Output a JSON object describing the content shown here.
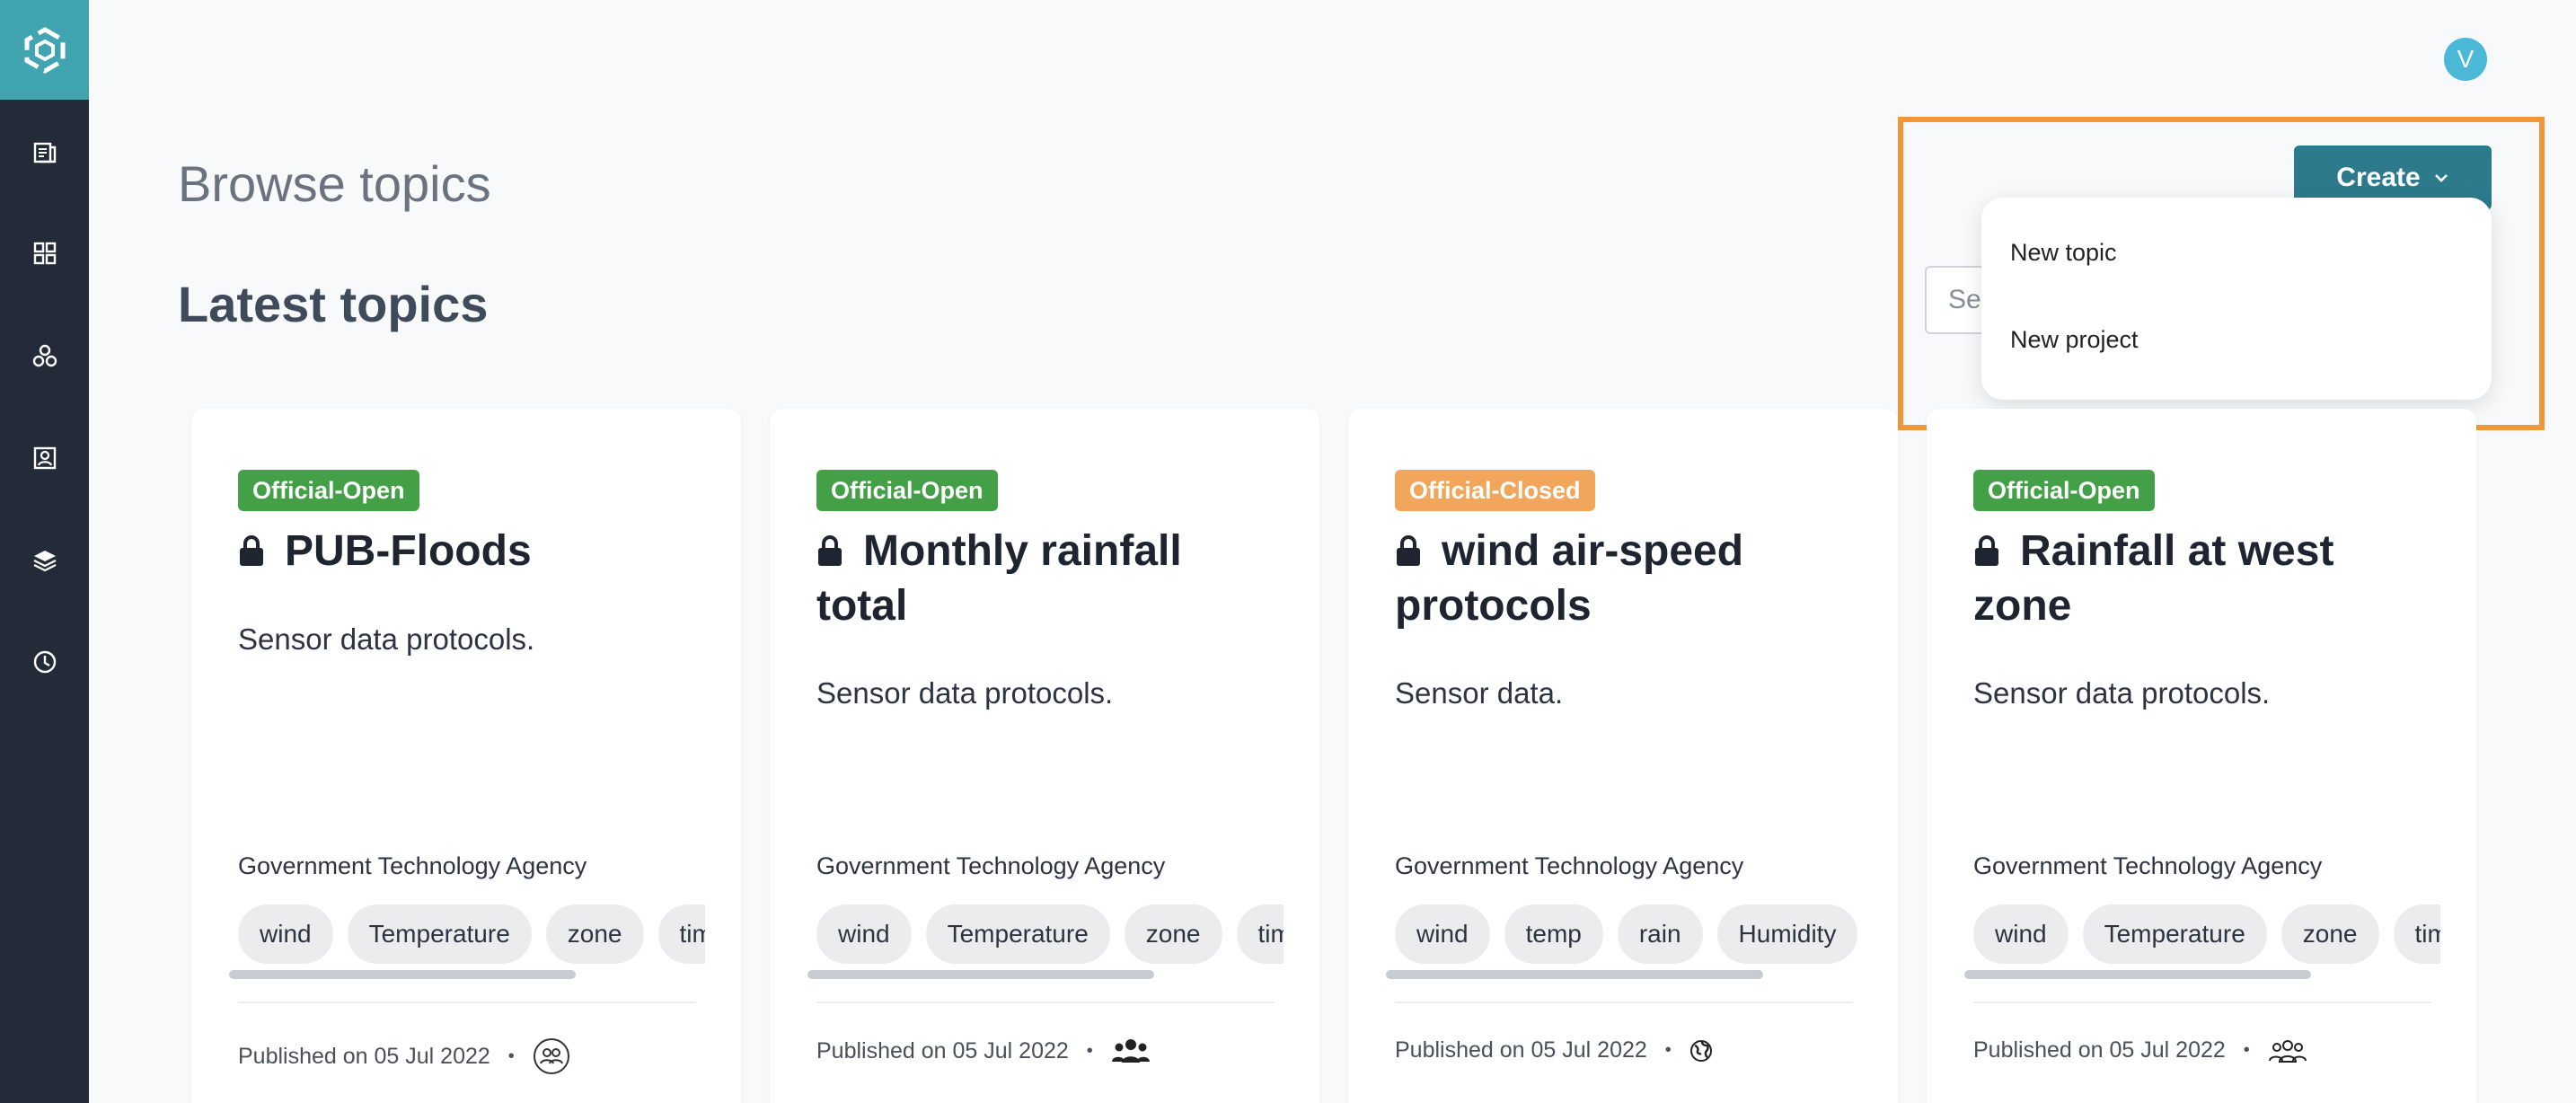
{
  "header": {
    "page_title": "Browse topics",
    "section_title": "Latest topics",
    "avatar_initial": "V",
    "create_label": "Create",
    "search_placeholder": "Se"
  },
  "dropdown": {
    "items": [
      {
        "label": "New topic"
      },
      {
        "label": "New project"
      }
    ]
  },
  "sidebar": {
    "items": [
      {
        "icon": "catalog-icon"
      },
      {
        "icon": "grid-icon"
      },
      {
        "icon": "network-icon"
      },
      {
        "icon": "contact-card-icon"
      },
      {
        "icon": "layers-icon"
      },
      {
        "icon": "clock-icon"
      }
    ]
  },
  "colors": {
    "sidebar": "#232b38",
    "logo_bg": "#41a5b1",
    "create_button": "#2c7a8c",
    "badge_open": "#43a047",
    "badge_closed": "#f2a65c",
    "highlight": "#f0973a",
    "avatar": "#4bb8d8"
  },
  "cards": [
    {
      "badge": "Official-Open",
      "title": "PUB-Floods",
      "description": "Sensor data protocols.",
      "agency": "Government Technology Agency",
      "tags": [
        "wind",
        "Temperature",
        "zone",
        "time"
      ],
      "published": "Published on 05 Jul 2022",
      "access_icon": "group-outline-icon"
    },
    {
      "badge": "Official-Open",
      "title": "Monthly rainfall total",
      "description": "Sensor data protocols.",
      "agency": "Government Technology Agency",
      "tags": [
        "wind",
        "Temperature",
        "zone",
        "time"
      ],
      "published": "Published on 05 Jul 2022",
      "access_icon": "group-filled-icon"
    },
    {
      "badge": "Official-Closed",
      "title": "wind air-speed protocols",
      "description": "Sensor data.",
      "agency": "Government Technology Agency",
      "tags": [
        "wind",
        "temp",
        "rain",
        "Humidity"
      ],
      "published": "Published on 05 Jul 2022",
      "access_icon": "globe-icon"
    },
    {
      "badge": "Official-Open",
      "title": "Rainfall at west zone",
      "description": "Sensor data protocols.",
      "agency": "Government Technology Agency",
      "tags": [
        "wind",
        "Temperature",
        "zone",
        "time"
      ],
      "published": "Published on 05 Jul 2022",
      "access_icon": "group-outline-icon"
    }
  ]
}
